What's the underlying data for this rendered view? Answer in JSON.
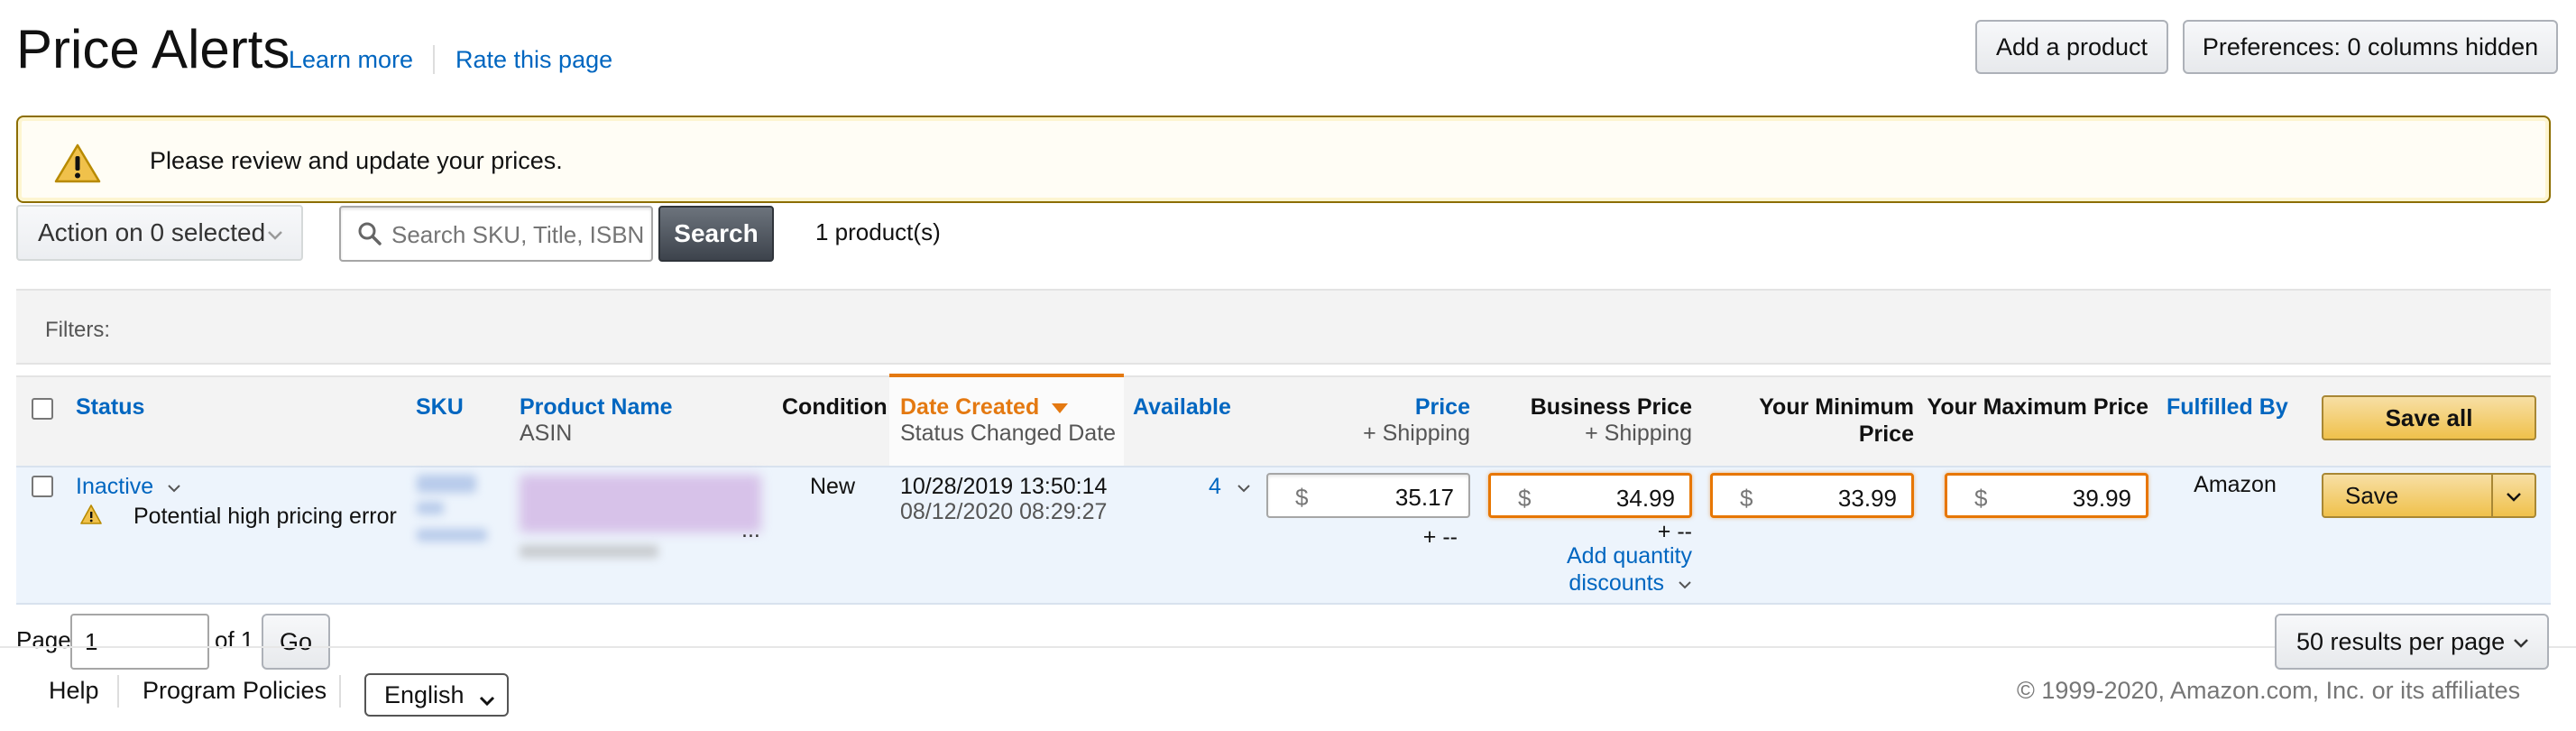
{
  "header": {
    "title": "Price Alerts",
    "learn_more": "Learn more",
    "rate_page": "Rate this page",
    "add_product": "Add a product",
    "preferences": "Preferences: 0 columns hidden"
  },
  "alert": {
    "message": "Please review and update your prices."
  },
  "toolbar": {
    "action_label": "Action on 0 selected",
    "search_placeholder": "Search SKU, Title, ISBN",
    "search_button": "Search",
    "product_count": "1 product(s)"
  },
  "filters": {
    "label": "Filters:"
  },
  "table": {
    "headers": {
      "status": "Status",
      "sku": "SKU",
      "product_name": "Product Name",
      "asin": "ASIN",
      "condition": "Condition",
      "date_created": "Date Created",
      "status_changed": "Status Changed Date",
      "available": "Available",
      "price": "Price",
      "price_shipping": "+ Shipping",
      "business_price": "Business Price",
      "business_shipping": "+ Shipping",
      "min_price_l1": "Your Minimum",
      "min_price_l2": "Price",
      "max_price": "Your Maximum Price",
      "fulfilled_by": "Fulfilled By",
      "save_all": "Save all"
    },
    "rows": [
      {
        "status": "Inactive",
        "warning": "Potential high pricing error",
        "ellipsis": "...",
        "condition": "New",
        "date_created": "10/28/2019 13:50:14",
        "status_changed": "08/12/2020 08:29:27",
        "available": "4",
        "currency": "$",
        "price": "35.17",
        "price_shipping": "+ --",
        "business_price": "34.99",
        "business_shipping": "+ --",
        "add_qty_l1": "Add quantity",
        "add_qty_l2": "discounts",
        "min_price": "33.99",
        "max_price": "39.99",
        "fulfilled_by": "Amazon",
        "save": "Save"
      }
    ]
  },
  "pagination": {
    "page_label": "Page",
    "page_value": "1",
    "of_label": "of 1",
    "go": "Go",
    "results_per_page": "50 results per page"
  },
  "footer": {
    "help": "Help",
    "program_policies": "Program Policies",
    "language": "English",
    "copyright": "© 1999-2020, Amazon.com, Inc. or its affiliates"
  },
  "colors": {
    "link": "#0066c0",
    "accent_orange": "#e47911",
    "primary_button": "#f0c14b",
    "row_highlight": "#edf4fc"
  },
  "icons": {
    "alert": "warning-triangle-icon",
    "search": "magnifier-icon",
    "chevron": "chevron-down-icon"
  }
}
